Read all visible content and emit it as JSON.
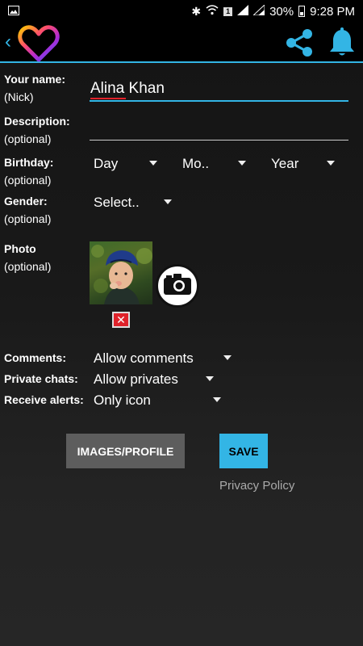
{
  "status": {
    "battery": "30%",
    "time": "9:28 PM",
    "sim_badge": "1"
  },
  "form": {
    "name": {
      "label": "Your name:",
      "sub": "(Nick)",
      "value": "Alina Khan"
    },
    "description": {
      "label": "Description:",
      "sub": "(optional)",
      "value": ""
    },
    "birthday": {
      "label": "Birthday:",
      "sub": "(optional)",
      "day": "Day",
      "month": "Mo..",
      "year": "Year"
    },
    "gender": {
      "label": "Gender:",
      "sub": "(optional)",
      "value": "Select.."
    },
    "photo": {
      "label": "Photo",
      "sub": "(optional)"
    },
    "comments": {
      "label": "Comments:",
      "value": "Allow comments"
    },
    "private_chats": {
      "label": "Private chats:",
      "value": "Allow privates"
    },
    "alerts": {
      "label": "Receive alerts:",
      "value": "Only icon"
    }
  },
  "buttons": {
    "images_profile": "IMAGES/PROFILE",
    "save": "SAVE"
  },
  "links": {
    "privacy": "Privacy Policy"
  },
  "colors": {
    "accent": "#33b5e5",
    "delete": "#e0222a",
    "background": "#161616"
  },
  "icons": [
    "back-icon",
    "heart-logo-icon",
    "share-icon",
    "bell-icon",
    "camera-icon",
    "delete-icon",
    "dropdown-caret-icon"
  ]
}
